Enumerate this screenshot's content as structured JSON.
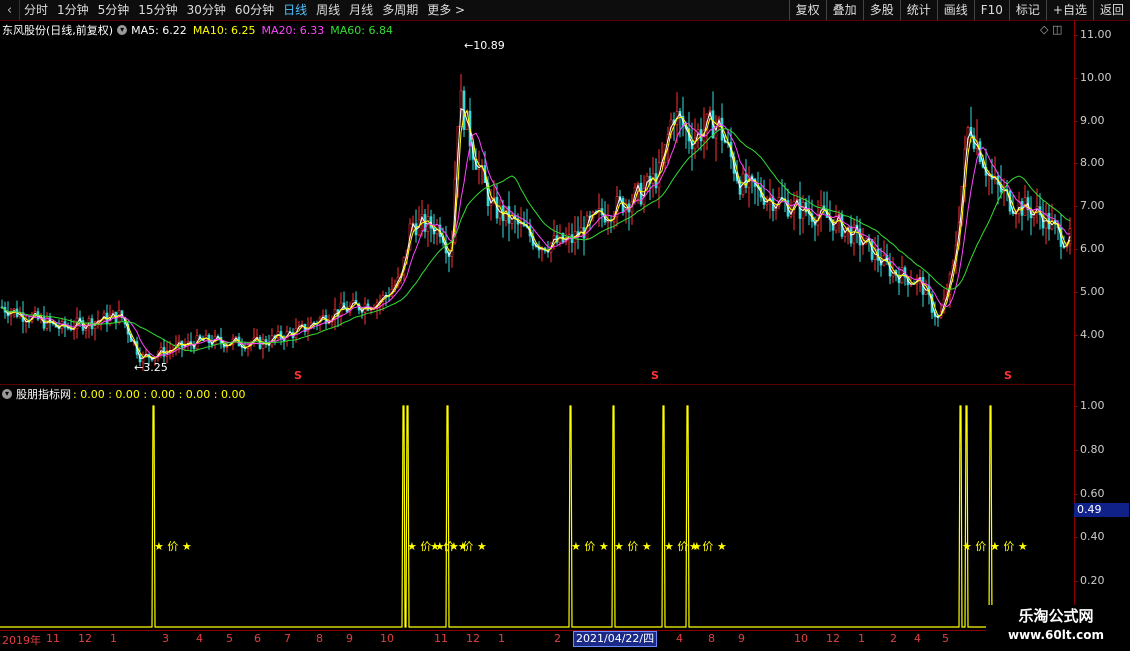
{
  "toolbar": {
    "nav_icon": "‹",
    "periods": [
      "分时",
      "1分钟",
      "5分钟",
      "15分钟",
      "30分钟",
      "60分钟",
      "日线",
      "周线",
      "月线",
      "多周期",
      "更多 >"
    ],
    "active_period": "日线",
    "actions": [
      "复权",
      "叠加",
      "多股",
      "统计",
      "画线",
      "F10",
      "标记",
      "+自选",
      "返回"
    ]
  },
  "main_chart": {
    "stock_title": "东风股份(日线,前复权)",
    "ma_legends": [
      {
        "label": "MA5: 6.22",
        "color": "#ffffff"
      },
      {
        "label": "MA10: 6.25",
        "color": "#ffff00"
      },
      {
        "label": "MA20: 6.33",
        "color": "#ff44ff"
      },
      {
        "label": "MA60: 6.84",
        "color": "#33dd33"
      }
    ],
    "high_marker": "10.89",
    "low_marker": "3.25",
    "price_ticks": [
      "11.00",
      "10.00",
      "9.00",
      "8.00",
      "7.00",
      "6.00",
      "5.00",
      "4.00"
    ],
    "s_marker": "S",
    "top_icons": "◇ ◫"
  },
  "indicator": {
    "title": "股朋指标网",
    "values": ": 0.00 : 0.00 : 0.00 : 0.00 : 0.00",
    "value_ticks": [
      "1.00",
      "0.80",
      "0.60",
      "0.40",
      "0.20"
    ],
    "current_value": "0.49",
    "signal_label": "★ 价 ★"
  },
  "date_axis": {
    "labels": [
      "2019年",
      "11",
      "12",
      "1",
      "3",
      "4",
      "5",
      "6",
      "7",
      "8",
      "9",
      "10",
      "11",
      "12",
      "1",
      "2",
      "4",
      "8",
      "9",
      "10",
      "12",
      "1",
      "2",
      "4",
      "5"
    ],
    "highlight": "2021/04/22/四"
  },
  "watermark": {
    "line1": "乐淘公式网",
    "line2": "www.60lt.com"
  },
  "colors": {
    "up": "#ff3333",
    "down": "#33dddd",
    "ma5": "#ffffff",
    "ma10": "#ffff00",
    "ma20": "#ff44ff",
    "ma60": "#33dd33",
    "signal": "#ffff00",
    "axis": "#8b0000"
  }
}
